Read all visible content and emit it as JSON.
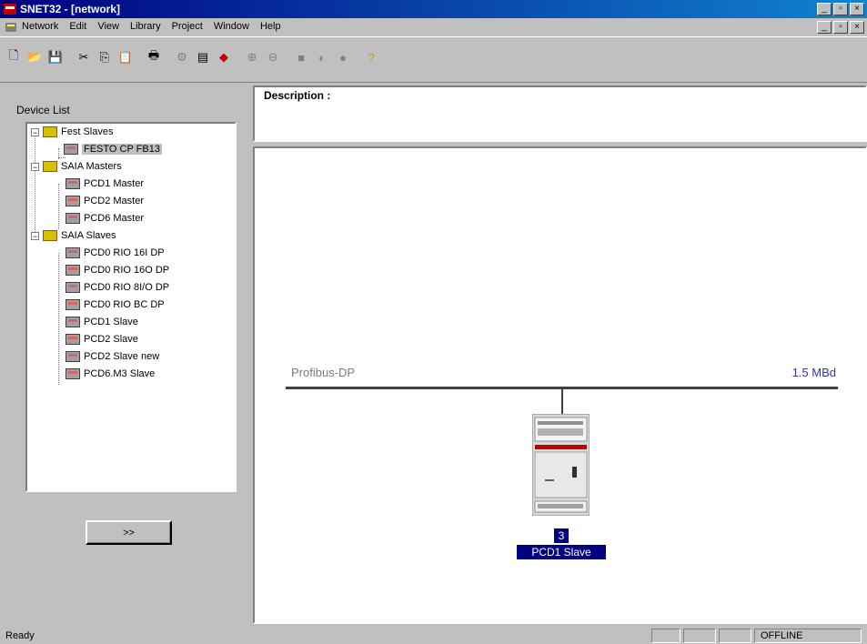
{
  "window": {
    "title": "SNET32 - [network]"
  },
  "menubar": {
    "items": [
      "Network",
      "Edit",
      "View",
      "Library",
      "Project",
      "Window",
      "Help"
    ]
  },
  "toolbar": {
    "buttons": [
      "new",
      "open",
      "save",
      "cut",
      "copy",
      "paste",
      "print",
      "properties",
      "bus",
      "color",
      "zoom-in",
      "zoom-out",
      "stop",
      "run",
      "record",
      "help"
    ]
  },
  "left_panel": {
    "label": "Device List",
    "more_button": ">>",
    "tree": [
      {
        "folder": "Fest Slaves",
        "items": [
          "FESTO CP FB13"
        ]
      },
      {
        "folder": "SAIA Masters",
        "items": [
          "PCD1 Master",
          "PCD2 Master",
          "PCD6 Master"
        ]
      },
      {
        "folder": "SAIA Slaves",
        "items": [
          "PCD0 RIO 16I DP",
          "PCD0 RIO 16O DP",
          "PCD0 RIO 8I/O DP",
          "PCD0 RIO BC DP",
          "PCD1 Slave",
          "PCD2 Slave",
          "PCD2 Slave new",
          "PCD6.M3 Slave"
        ]
      }
    ]
  },
  "description": {
    "label": "Description :"
  },
  "network": {
    "bus_name": "Profibus-DP",
    "bus_rate": "1.5 MBd",
    "device": {
      "address": "3",
      "name": "PCD1 Slave"
    }
  },
  "status": {
    "message": "Ready",
    "mode": "OFFLINE"
  },
  "colors": {
    "title_bar": "#000080",
    "selection": "#000080",
    "bus_rate": "#3030c0"
  }
}
